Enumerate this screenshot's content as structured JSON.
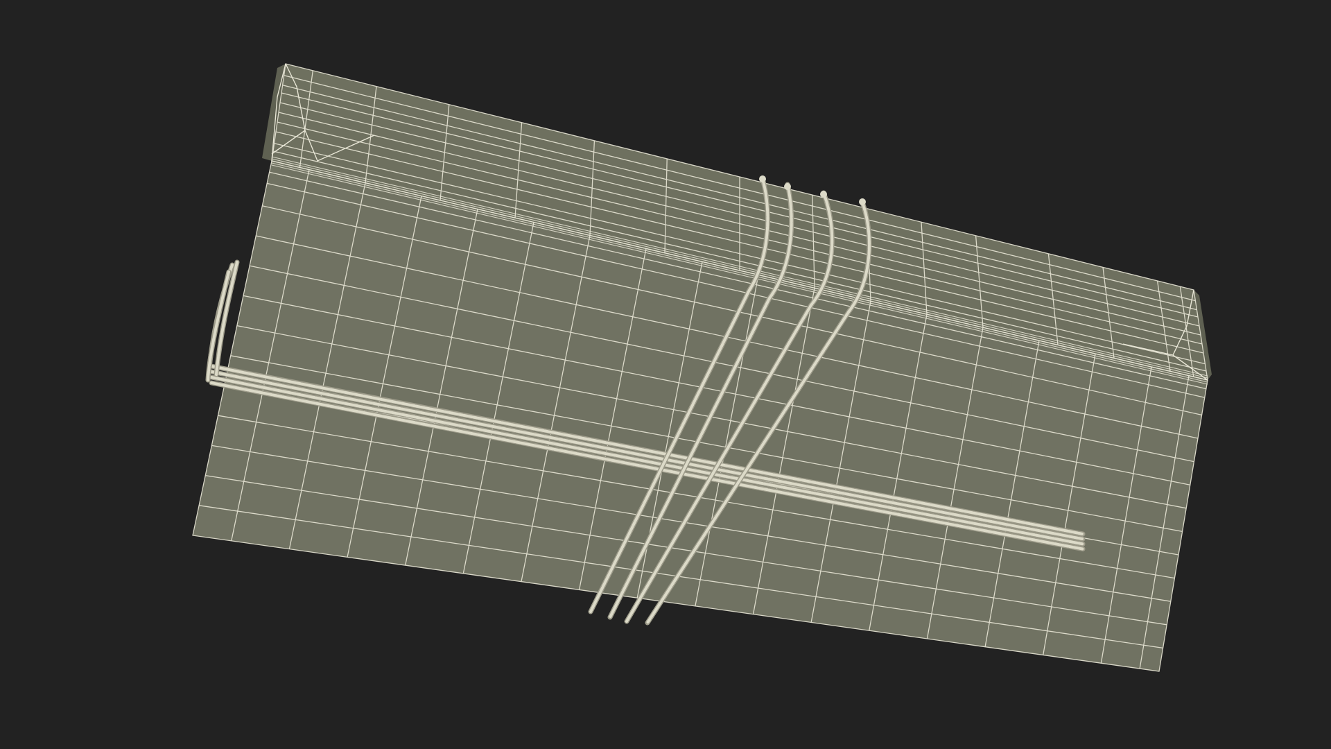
{
  "scene": {
    "subject": "wireframe-wrapped-parcel-with-twine",
    "colors": {
      "background": "#222222",
      "surface_top": "#6e705f",
      "surface_bottom": "#707262",
      "surface_side": "#5f6152",
      "wire": "#e8e6d6",
      "twine": "#dcdac8",
      "twine_shadow": "#9d9b8a"
    }
  }
}
